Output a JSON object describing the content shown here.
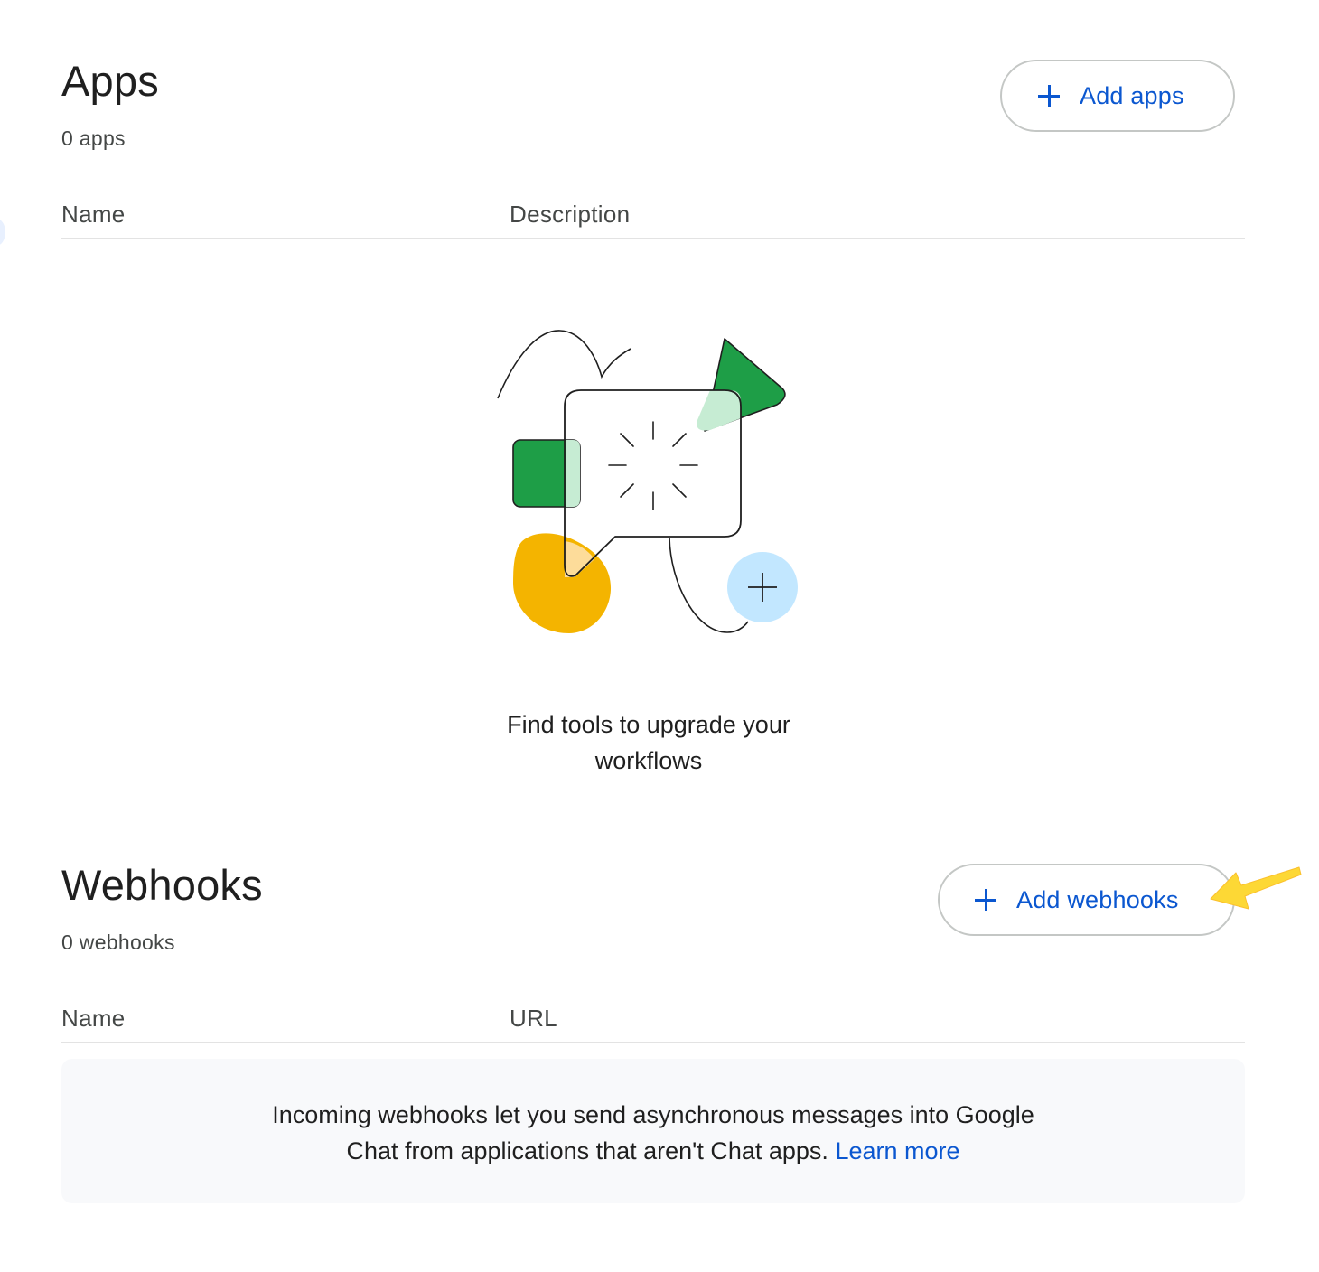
{
  "apps": {
    "title": "Apps",
    "count": "0 apps",
    "add_button_label": "Add apps",
    "columns": [
      "Name",
      "Description"
    ],
    "empty_state": {
      "line1": "Find tools to upgrade your",
      "line2": "workflows"
    }
  },
  "webhooks": {
    "title": "Webhooks",
    "count": "0 webhooks",
    "add_button_label": "Add webhooks",
    "columns": [
      "Name",
      "URL"
    ],
    "info": {
      "line1": "Incoming webhooks let you send asynchronous messages into Google",
      "line2": "Chat from applications that aren't Chat apps.",
      "link_label": "Learn more"
    }
  },
  "icons": {
    "add": "plus-icon",
    "illustration": "chat-apps-illustration",
    "annotation": "yellow-arrow"
  },
  "colors": {
    "accent": "#0b57d0",
    "border": "#c4c7c5",
    "divider": "#e3e3e3",
    "info_background": "#f8f9fb",
    "arrow": "#fdd835",
    "illustration_green": "#1e9e47",
    "illustration_light_green": "#c6ecd3",
    "illustration_yellow": "#f4b400",
    "illustration_light_blue": "#c2e7ff"
  }
}
